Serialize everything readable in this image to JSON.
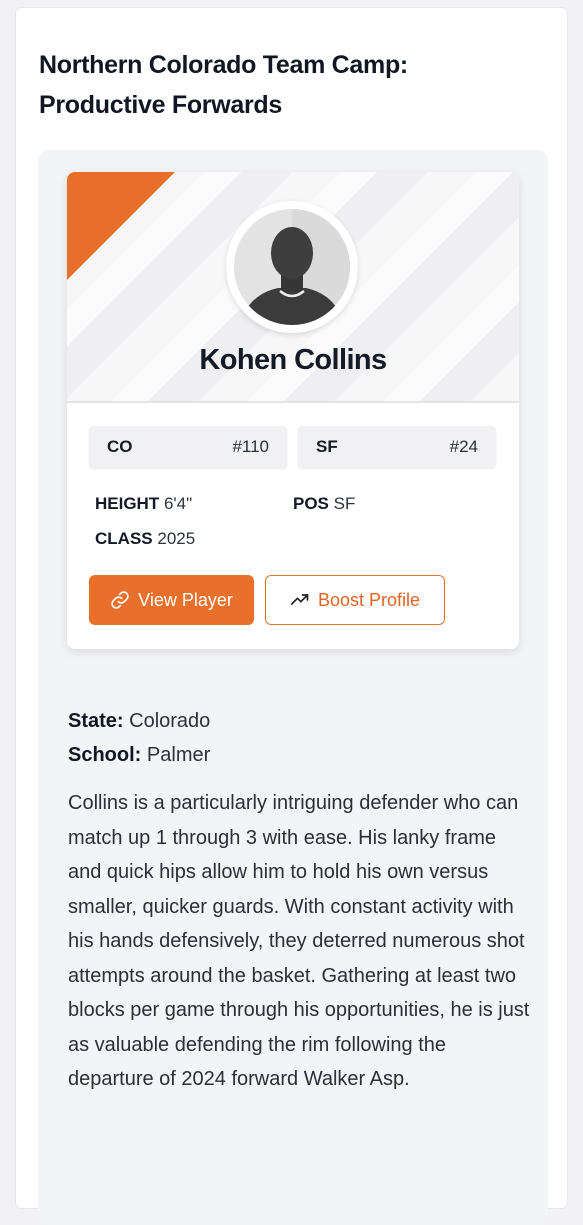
{
  "article": {
    "title_line1": "Northern Colorado Team Camp:",
    "title_line2": "Productive Forwards"
  },
  "player": {
    "name": "Kohen Collins",
    "state_chip": "CO",
    "state_number": "#110",
    "position_chip": "SF",
    "position_number": "#24",
    "height_label": "HEIGHT",
    "height_value": "6'4\"",
    "pos_label": "POS",
    "pos_value": "SF",
    "class_label": "CLASS",
    "class_value": "2025",
    "avatar_icon": "person-silhouette-icon"
  },
  "actions": {
    "view_label": "View Player",
    "view_icon": "link-icon",
    "boost_label": "Boost Profile",
    "boost_icon": "trending-up-icon"
  },
  "details": {
    "state_label": "State:",
    "state_value": "Colorado",
    "school_label": "School:",
    "school_value": "Palmer"
  },
  "bio": "Collins is a particularly intriguing defender who can match up 1 through 3 with ease. His lanky frame and quick hips allow him to hold his own versus smaller, quicker guards. With constant activity with his hands defensively, they deterred numerous shot attempts around the basket. Gathering at least two blocks per game through his opportunities, he is just as valuable defending the rim following the departure of 2024 forward Walker Asp.",
  "colors": {
    "accent": "#e8702b",
    "panel": "#f3f4f6"
  }
}
